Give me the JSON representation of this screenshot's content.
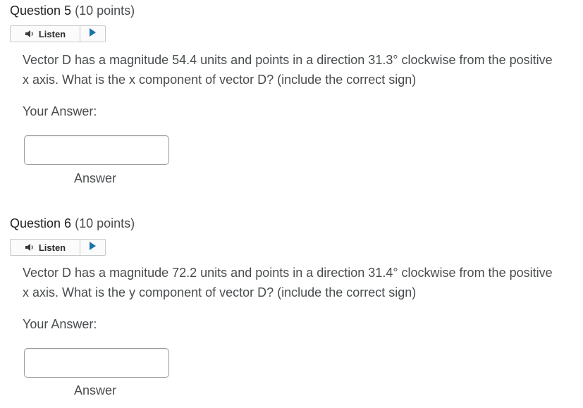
{
  "questions": [
    {
      "number": "Question 5",
      "points": "(10 points)",
      "listen_label": "Listen",
      "text": "Vector D has a magnitude 54.4 units and points in a direction 31.3° clockwise from the positive x axis. What is the x  component of vector D? (include the correct sign)",
      "your_answer_label": "Your Answer:",
      "answer_value": "",
      "answer_label": "Answer"
    },
    {
      "number": "Question 6",
      "points": "(10 points)",
      "listen_label": "Listen",
      "text": "Vector D has a magnitude 72.2 units and points in a direction 31.4° clockwise from the positive x axis. What is the y component of vector D? (include the correct sign)",
      "your_answer_label": "Your Answer:",
      "answer_value": "",
      "answer_label": "Answer"
    }
  ],
  "icons": {
    "speaker": "speaker-icon",
    "play": "play-icon"
  },
  "colors": {
    "play_accent": "#1a73a8",
    "speaker": "#3a3a3a"
  }
}
